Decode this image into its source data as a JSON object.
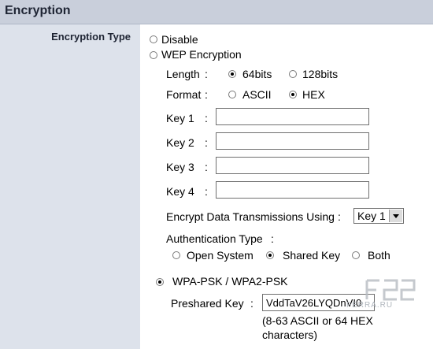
{
  "header": {
    "title": "Encryption"
  },
  "form": {
    "encryption_type_label": "Encryption Type",
    "option_disable": "Disable",
    "option_wep": "WEP Encryption",
    "length_label": "Length",
    "length_64": "64bits",
    "length_128": "128bits",
    "format_label": "Format",
    "format_ascii": "ASCII",
    "format_hex": "HEX",
    "colon": ":",
    "keys": [
      "Key 1",
      "Key 2",
      "Key 3",
      "Key 4"
    ],
    "encrypt_using_label": "Encrypt Data Transmissions Using",
    "encrypt_using_value": "Key 1",
    "auth_type_label": "Authentication Type",
    "auth_open": "Open System",
    "auth_shared": "Shared Key",
    "auth_both": "Both",
    "option_wpa": "WPA-PSK / WPA2-PSK",
    "psk_label": "Preshared Key",
    "psk_value": "VddTaV26LYQDnVI0",
    "psk_hint_line1": "(8-63 ASCII or 64 HEX",
    "psk_hint_line2": "characters)"
  },
  "watermark": {
    "text": "FERRA.RU"
  }
}
